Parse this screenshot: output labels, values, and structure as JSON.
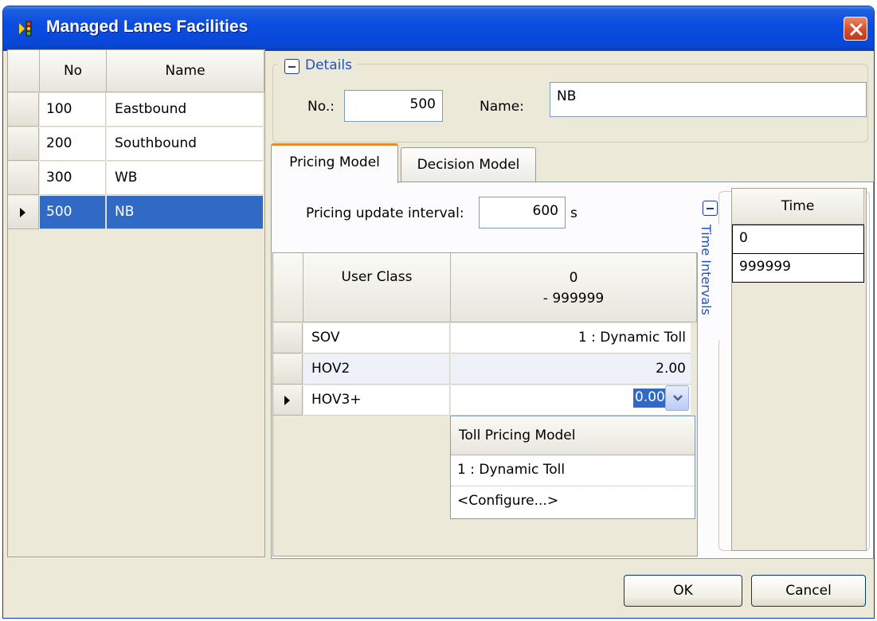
{
  "window": {
    "title": "Managed Lanes Facilities"
  },
  "facilities": {
    "columns": [
      "No",
      "Name"
    ],
    "rows": [
      {
        "no": "100",
        "name": "Eastbound"
      },
      {
        "no": "200",
        "name": "Southbound"
      },
      {
        "no": "300",
        "name": "WB"
      },
      {
        "no": "500",
        "name": "NB"
      }
    ]
  },
  "details": {
    "legend": "Details",
    "no_label": "No.:",
    "no_value": "500",
    "name_label": "Name:",
    "name_value": "NB"
  },
  "tabs": [
    "Pricing Model",
    "Decision Model"
  ],
  "pricing": {
    "interval_label": "Pricing update interval:",
    "interval_value": "600",
    "interval_unit": "s",
    "table": {
      "col_user_class": "User Class",
      "col_interval_from": "0",
      "col_interval_to": "- 999999",
      "rows": [
        {
          "user_class": "SOV",
          "value": "1 : Dynamic Toll"
        },
        {
          "user_class": "HOV2",
          "value": "2.00"
        },
        {
          "user_class": "HOV3+",
          "value": "0.00"
        }
      ],
      "editing_value": "0.00"
    },
    "dropdown": {
      "header": "Toll Pricing Model",
      "options": [
        "1 : Dynamic Toll",
        "<Configure...>"
      ]
    }
  },
  "time_intervals": {
    "legend": "Time Intervals",
    "header": "Time",
    "rows": [
      "0",
      "999999"
    ]
  },
  "buttons": {
    "ok": "OK",
    "cancel": "Cancel"
  }
}
